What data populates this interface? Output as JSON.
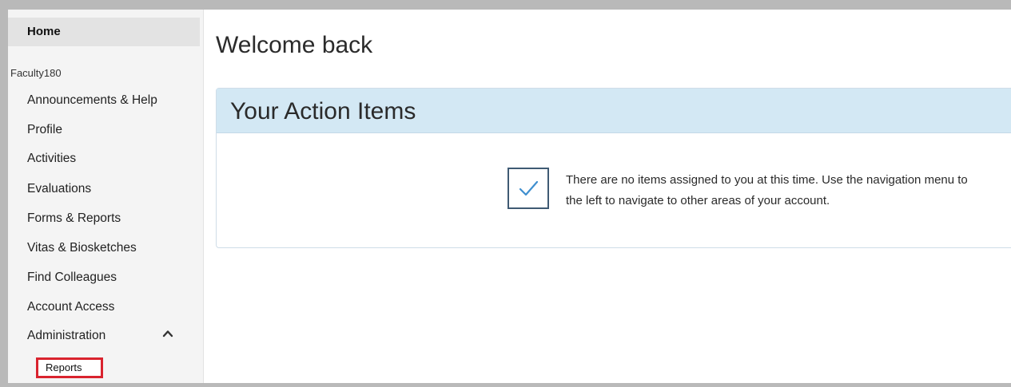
{
  "sidebar": {
    "home": "Home",
    "section": "Faculty180",
    "items": [
      "Announcements & Help",
      "Profile",
      "Activities",
      "Evaluations",
      "Forms & Reports",
      "Vitas & Biosketches",
      "Find Colleagues",
      "Account Access",
      "Administration"
    ],
    "administration_sub": "Reports",
    "chevron_icon": "chevron-up-icon"
  },
  "main": {
    "heading": "Welcome back",
    "action_items": {
      "title": "Your Action Items",
      "icon": "checkmark-icon",
      "message": "There are no items assigned to you at this time. Use the navigation menu to the left to navigate to other areas of your account."
    }
  },
  "colors": {
    "panel_header": "#d3e8f4",
    "highlight_border": "#d9232e",
    "frame": "#b9b9b9"
  }
}
